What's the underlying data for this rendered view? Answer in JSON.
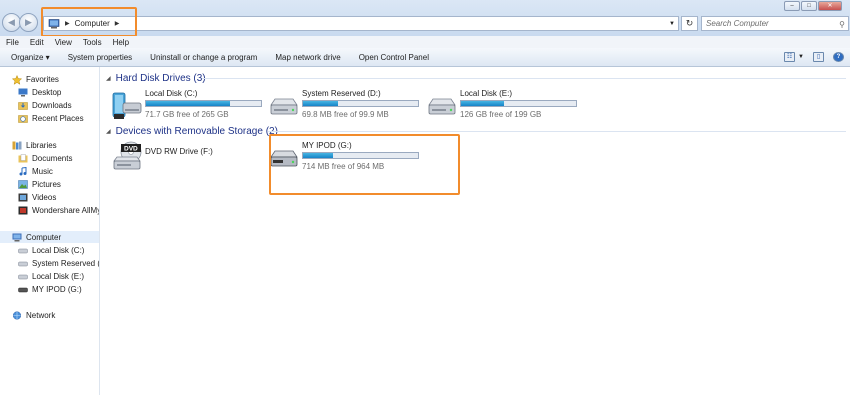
{
  "address": {
    "crumb": "Computer"
  },
  "search": {
    "placeholder": "Search Computer"
  },
  "window_controls": [
    "–",
    "□",
    "✕"
  ],
  "menu": [
    "File",
    "Edit",
    "View",
    "Tools",
    "Help"
  ],
  "toolbar": {
    "organize": "Organize ▾",
    "system_properties": "System properties",
    "uninstall": "Uninstall or change a program",
    "map_drive": "Map network drive",
    "control_panel": "Open Control Panel"
  },
  "sidebar": {
    "favorites": {
      "label": "Favorites",
      "items": [
        "Desktop",
        "Downloads",
        "Recent Places"
      ]
    },
    "libraries": {
      "label": "Libraries",
      "items": [
        "Documents",
        "Music",
        "Pictures",
        "Videos",
        "Wondershare AllMy"
      ]
    },
    "computer": {
      "label": "Computer",
      "items": [
        "Local Disk (C:)",
        "System Reserved (D:",
        "Local Disk (E:)",
        "MY IPOD (G:)"
      ]
    },
    "network": {
      "label": "Network"
    }
  },
  "groups": {
    "hdd": {
      "header": "Hard Disk Drives (3)",
      "drives": [
        {
          "name": "Local Disk (C:)",
          "free": "71.7 GB free of 265 GB",
          "used_fraction": 0.73
        },
        {
          "name": "System Reserved (D:)",
          "free": "69.8 MB free of 99.9 MB",
          "used_fraction": 0.3
        },
        {
          "name": "Local Disk (E:)",
          "free": "126 GB free of 199 GB",
          "used_fraction": 0.37
        }
      ]
    },
    "removable": {
      "header": "Devices with Removable Storage (2)",
      "dvd": {
        "name": "DVD RW Drive (F:)",
        "icon_text": "DVD"
      },
      "ipod": {
        "name": "MY IPOD (G:)",
        "free": "714 MB free of 964 MB",
        "used_fraction": 0.26
      }
    }
  },
  "colors": {
    "annotation": "#f28c2c",
    "bar_fill": "#1683c7",
    "group_header": "#1e3287"
  }
}
